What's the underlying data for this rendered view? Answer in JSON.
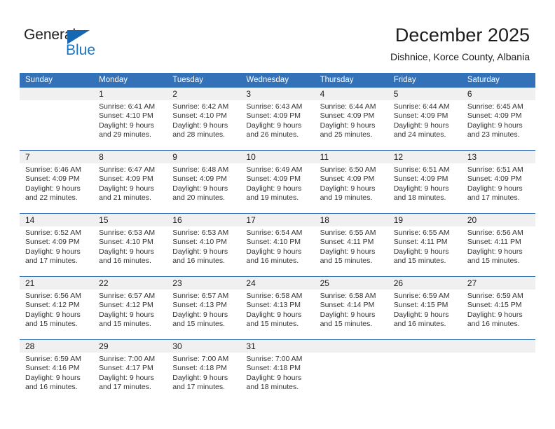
{
  "logo": {
    "word_primary": "General",
    "word_secondary": "Blue",
    "triangle_icon": "triangle-icon",
    "primary_color": "#231f20",
    "secondary_color": "#1a74c4",
    "triangle_color": "#1668b3"
  },
  "header": {
    "title": "December 2025",
    "subtitle": "Dishnice, Korce County, Albania"
  },
  "theme": {
    "header_blue": "#3372b8",
    "day_number_bg": "#f0f0f0",
    "text_color": "#333333"
  },
  "weekdays": [
    "Sunday",
    "Monday",
    "Tuesday",
    "Wednesday",
    "Thursday",
    "Friday",
    "Saturday"
  ],
  "weeks": [
    [
      {
        "day": "",
        "sunrise": "",
        "sunset": "",
        "daylight_line1": "",
        "daylight_line2": "",
        "empty": true
      },
      {
        "day": "1",
        "sunrise": "Sunrise: 6:41 AM",
        "sunset": "Sunset: 4:10 PM",
        "daylight_line1": "Daylight: 9 hours",
        "daylight_line2": "and 29 minutes."
      },
      {
        "day": "2",
        "sunrise": "Sunrise: 6:42 AM",
        "sunset": "Sunset: 4:10 PM",
        "daylight_line1": "Daylight: 9 hours",
        "daylight_line2": "and 28 minutes."
      },
      {
        "day": "3",
        "sunrise": "Sunrise: 6:43 AM",
        "sunset": "Sunset: 4:09 PM",
        "daylight_line1": "Daylight: 9 hours",
        "daylight_line2": "and 26 minutes."
      },
      {
        "day": "4",
        "sunrise": "Sunrise: 6:44 AM",
        "sunset": "Sunset: 4:09 PM",
        "daylight_line1": "Daylight: 9 hours",
        "daylight_line2": "and 25 minutes."
      },
      {
        "day": "5",
        "sunrise": "Sunrise: 6:44 AM",
        "sunset": "Sunset: 4:09 PM",
        "daylight_line1": "Daylight: 9 hours",
        "daylight_line2": "and 24 minutes."
      },
      {
        "day": "6",
        "sunrise": "Sunrise: 6:45 AM",
        "sunset": "Sunset: 4:09 PM",
        "daylight_line1": "Daylight: 9 hours",
        "daylight_line2": "and 23 minutes."
      }
    ],
    [
      {
        "day": "7",
        "sunrise": "Sunrise: 6:46 AM",
        "sunset": "Sunset: 4:09 PM",
        "daylight_line1": "Daylight: 9 hours",
        "daylight_line2": "and 22 minutes."
      },
      {
        "day": "8",
        "sunrise": "Sunrise: 6:47 AM",
        "sunset": "Sunset: 4:09 PM",
        "daylight_line1": "Daylight: 9 hours",
        "daylight_line2": "and 21 minutes."
      },
      {
        "day": "9",
        "sunrise": "Sunrise: 6:48 AM",
        "sunset": "Sunset: 4:09 PM",
        "daylight_line1": "Daylight: 9 hours",
        "daylight_line2": "and 20 minutes."
      },
      {
        "day": "10",
        "sunrise": "Sunrise: 6:49 AM",
        "sunset": "Sunset: 4:09 PM",
        "daylight_line1": "Daylight: 9 hours",
        "daylight_line2": "and 19 minutes."
      },
      {
        "day": "11",
        "sunrise": "Sunrise: 6:50 AM",
        "sunset": "Sunset: 4:09 PM",
        "daylight_line1": "Daylight: 9 hours",
        "daylight_line2": "and 19 minutes."
      },
      {
        "day": "12",
        "sunrise": "Sunrise: 6:51 AM",
        "sunset": "Sunset: 4:09 PM",
        "daylight_line1": "Daylight: 9 hours",
        "daylight_line2": "and 18 minutes."
      },
      {
        "day": "13",
        "sunrise": "Sunrise: 6:51 AM",
        "sunset": "Sunset: 4:09 PM",
        "daylight_line1": "Daylight: 9 hours",
        "daylight_line2": "and 17 minutes."
      }
    ],
    [
      {
        "day": "14",
        "sunrise": "Sunrise: 6:52 AM",
        "sunset": "Sunset: 4:09 PM",
        "daylight_line1": "Daylight: 9 hours",
        "daylight_line2": "and 17 minutes."
      },
      {
        "day": "15",
        "sunrise": "Sunrise: 6:53 AM",
        "sunset": "Sunset: 4:10 PM",
        "daylight_line1": "Daylight: 9 hours",
        "daylight_line2": "and 16 minutes."
      },
      {
        "day": "16",
        "sunrise": "Sunrise: 6:53 AM",
        "sunset": "Sunset: 4:10 PM",
        "daylight_line1": "Daylight: 9 hours",
        "daylight_line2": "and 16 minutes."
      },
      {
        "day": "17",
        "sunrise": "Sunrise: 6:54 AM",
        "sunset": "Sunset: 4:10 PM",
        "daylight_line1": "Daylight: 9 hours",
        "daylight_line2": "and 16 minutes."
      },
      {
        "day": "18",
        "sunrise": "Sunrise: 6:55 AM",
        "sunset": "Sunset: 4:11 PM",
        "daylight_line1": "Daylight: 9 hours",
        "daylight_line2": "and 15 minutes."
      },
      {
        "day": "19",
        "sunrise": "Sunrise: 6:55 AM",
        "sunset": "Sunset: 4:11 PM",
        "daylight_line1": "Daylight: 9 hours",
        "daylight_line2": "and 15 minutes."
      },
      {
        "day": "20",
        "sunrise": "Sunrise: 6:56 AM",
        "sunset": "Sunset: 4:11 PM",
        "daylight_line1": "Daylight: 9 hours",
        "daylight_line2": "and 15 minutes."
      }
    ],
    [
      {
        "day": "21",
        "sunrise": "Sunrise: 6:56 AM",
        "sunset": "Sunset: 4:12 PM",
        "daylight_line1": "Daylight: 9 hours",
        "daylight_line2": "and 15 minutes."
      },
      {
        "day": "22",
        "sunrise": "Sunrise: 6:57 AM",
        "sunset": "Sunset: 4:12 PM",
        "daylight_line1": "Daylight: 9 hours",
        "daylight_line2": "and 15 minutes."
      },
      {
        "day": "23",
        "sunrise": "Sunrise: 6:57 AM",
        "sunset": "Sunset: 4:13 PM",
        "daylight_line1": "Daylight: 9 hours",
        "daylight_line2": "and 15 minutes."
      },
      {
        "day": "24",
        "sunrise": "Sunrise: 6:58 AM",
        "sunset": "Sunset: 4:13 PM",
        "daylight_line1": "Daylight: 9 hours",
        "daylight_line2": "and 15 minutes."
      },
      {
        "day": "25",
        "sunrise": "Sunrise: 6:58 AM",
        "sunset": "Sunset: 4:14 PM",
        "daylight_line1": "Daylight: 9 hours",
        "daylight_line2": "and 15 minutes."
      },
      {
        "day": "26",
        "sunrise": "Sunrise: 6:59 AM",
        "sunset": "Sunset: 4:15 PM",
        "daylight_line1": "Daylight: 9 hours",
        "daylight_line2": "and 16 minutes."
      },
      {
        "day": "27",
        "sunrise": "Sunrise: 6:59 AM",
        "sunset": "Sunset: 4:15 PM",
        "daylight_line1": "Daylight: 9 hours",
        "daylight_line2": "and 16 minutes."
      }
    ],
    [
      {
        "day": "28",
        "sunrise": "Sunrise: 6:59 AM",
        "sunset": "Sunset: 4:16 PM",
        "daylight_line1": "Daylight: 9 hours",
        "daylight_line2": "and 16 minutes."
      },
      {
        "day": "29",
        "sunrise": "Sunrise: 7:00 AM",
        "sunset": "Sunset: 4:17 PM",
        "daylight_line1": "Daylight: 9 hours",
        "daylight_line2": "and 17 minutes."
      },
      {
        "day": "30",
        "sunrise": "Sunrise: 7:00 AM",
        "sunset": "Sunset: 4:18 PM",
        "daylight_line1": "Daylight: 9 hours",
        "daylight_line2": "and 17 minutes."
      },
      {
        "day": "31",
        "sunrise": "Sunrise: 7:00 AM",
        "sunset": "Sunset: 4:18 PM",
        "daylight_line1": "Daylight: 9 hours",
        "daylight_line2": "and 18 minutes."
      },
      {
        "day": "",
        "sunrise": "",
        "sunset": "",
        "daylight_line1": "",
        "daylight_line2": "",
        "empty": true
      },
      {
        "day": "",
        "sunrise": "",
        "sunset": "",
        "daylight_line1": "",
        "daylight_line2": "",
        "empty": true
      },
      {
        "day": "",
        "sunrise": "",
        "sunset": "",
        "daylight_line1": "",
        "daylight_line2": "",
        "empty": true
      }
    ]
  ]
}
